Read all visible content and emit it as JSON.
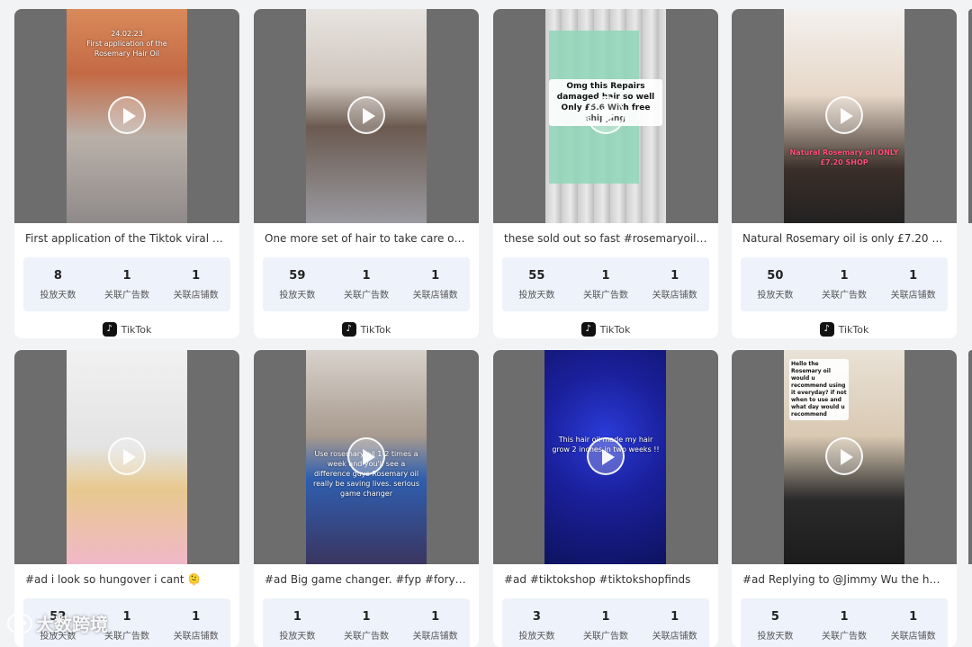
{
  "labels": {
    "days": "投放天数",
    "ads": "关联广告数",
    "shops": "关联店铺数",
    "platform": "TikTok"
  },
  "watermark": "大数跨境",
  "cards": [
    {
      "title": "First application of the Tiktok viral Nat...",
      "overlay": "24.02.23\nFirst application of the\nRosemary Hair Oil",
      "days": "8",
      "ads": "1",
      "shops": "1"
    },
    {
      "title": "One more set of hair to take care of ...",
      "overlay": "",
      "days": "59",
      "ads": "1",
      "shops": "1"
    },
    {
      "title": "these sold out so fast #rosemaryoil #h...",
      "overlay": "Omg this Repairs damaged hair so well Only £5.6 With free shipping",
      "days": "55",
      "ads": "1",
      "shops": "1"
    },
    {
      "title": "Natural Rosemary oil is only £7.20 TO...",
      "overlay": "Natural Rosemary oil ONLY £7.20 SHOP",
      "days": "50",
      "ads": "1",
      "shops": "1"
    },
    {
      "title": "#ad i look so hungover i cant 🫠",
      "overlay": "",
      "days": "52",
      "ads": "1",
      "shops": "1"
    },
    {
      "title": "#ad Big game changer. #fyp #foryoup...",
      "overlay": "Use rosemary oil 1-2 times a week and you'll see a difference guys Rosemary oil really be saving lives. serious game changer",
      "days": "1",
      "ads": "1",
      "shops": "1"
    },
    {
      "title": "#ad #tiktokshop #tiktokshopfinds",
      "overlay": "This hair oil made my hair grow 2 inches in two weeks !!",
      "days": "3",
      "ads": "1",
      "shops": "1"
    },
    {
      "title": "#ad Replying to @Jimmy Wu the hair ...",
      "overlay": "Hello the Rosemary oil would u recommend using it everyday? if not when to use and what day would u recommend",
      "days": "5",
      "ads": "1",
      "shops": "1"
    }
  ],
  "colors": {
    "page_bg": "#f2f3f5",
    "stats_bg": "#eef2fb",
    "thumb_bg": "#6d6d6d"
  }
}
